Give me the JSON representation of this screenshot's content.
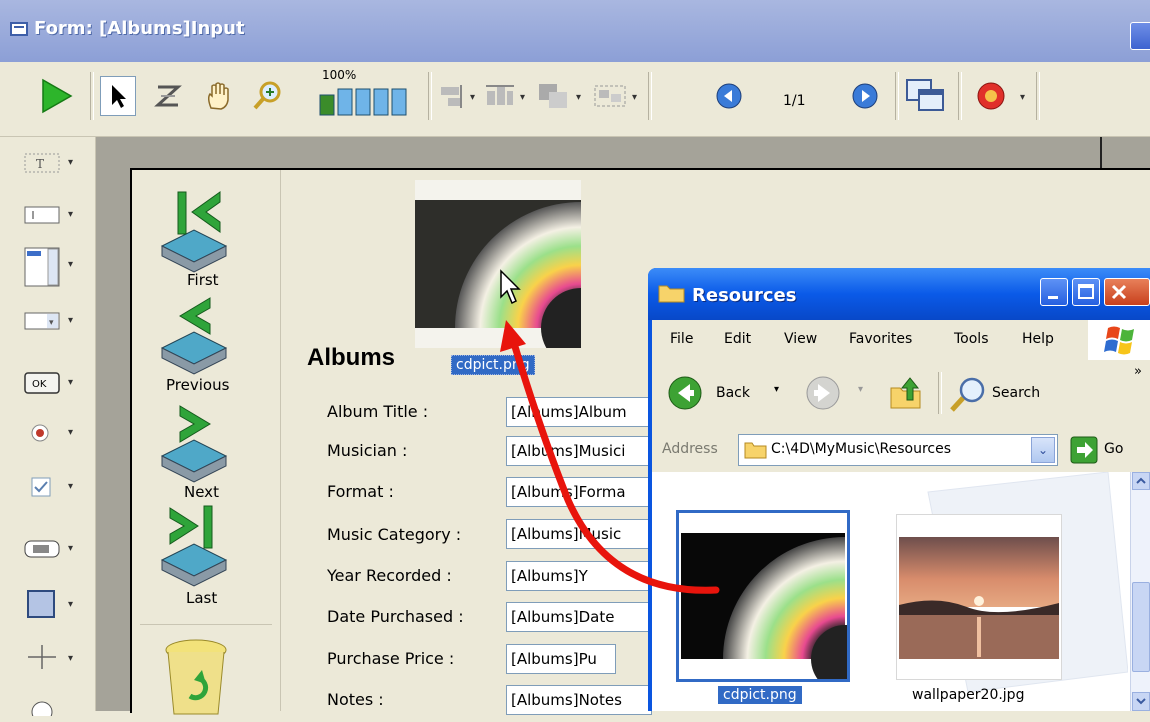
{
  "window": {
    "title": "Form: [Albums]Input"
  },
  "toolbar": {
    "zoom_label": "100%",
    "page_indicator": "1/1"
  },
  "nav_buttons": [
    {
      "label": "First"
    },
    {
      "label": "Previous"
    },
    {
      "label": "Next"
    },
    {
      "label": "Last"
    }
  ],
  "form": {
    "title": "Albums",
    "picture_caption": "cdpict.png",
    "fields": [
      {
        "label": "Album Title :",
        "value": "[Albums]Album"
      },
      {
        "label": "Musician :",
        "value": "[Albums]Musici"
      },
      {
        "label": "Format :",
        "value": "[Albums]Forma"
      },
      {
        "label": "Music Category :",
        "value": "[Albums]Music"
      },
      {
        "label": "Year Recorded :",
        "value": "[Albums]Y"
      },
      {
        "label": "Date Purchased :",
        "value": "[Albums]Date"
      },
      {
        "label": "Purchase Price :",
        "value": "[Albums]Pu"
      },
      {
        "label": "Notes :",
        "value": "[Albums]Notes"
      }
    ]
  },
  "explorer": {
    "title": "Resources",
    "menu": [
      "File",
      "Edit",
      "View",
      "Favorites",
      "Tools",
      "Help"
    ],
    "back_label": "Back",
    "search_label": "Search",
    "address_label": "Address",
    "address_value": "C:\\4D\\MyMusic\\Resources",
    "go_label": "Go",
    "more_chevron": "»",
    "files": [
      {
        "name": "cdpict.png",
        "selected": true
      },
      {
        "name": "wallpaper20.jpg",
        "selected": false
      }
    ]
  },
  "colors": {
    "xp_blue": "#0A55E0",
    "drag_arrow": "#E8140C",
    "selection": "#316AC5"
  }
}
